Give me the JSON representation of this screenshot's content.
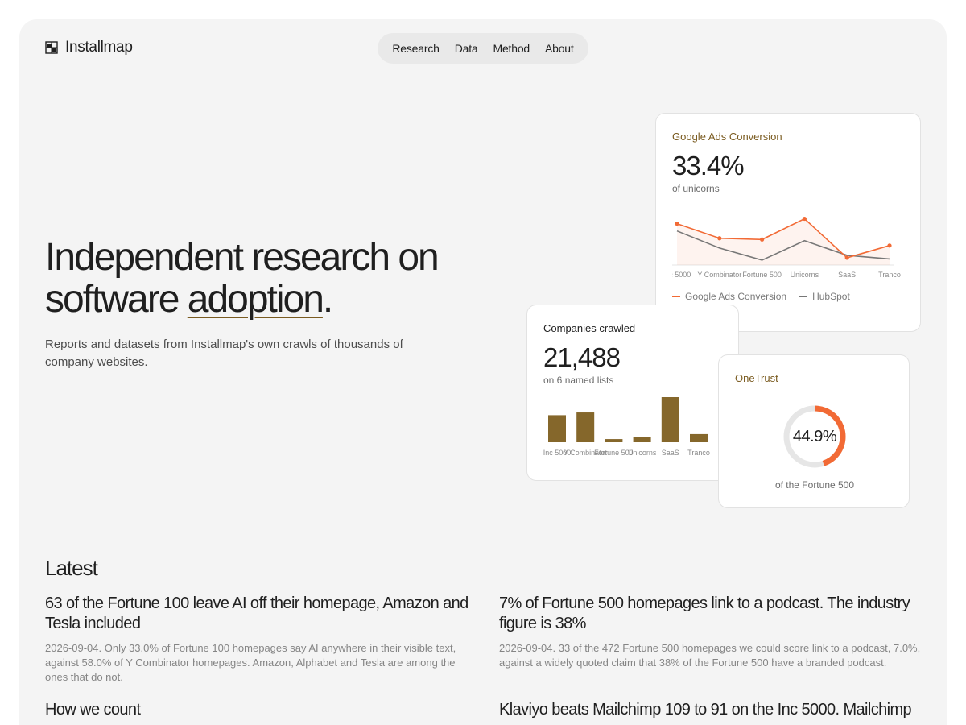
{
  "brand": {
    "name": "Installmap",
    "logo_icon": "grid-logo-icon"
  },
  "nav": {
    "items": [
      "Research",
      "Data",
      "Method",
      "About"
    ]
  },
  "hero": {
    "title_line1": "Independent research on",
    "title_line2_a": "software ",
    "title_line2_b": "adoption",
    "title_line2_c": ".",
    "subtitle": "Reports and datasets from Installmap's own crawls of thousands of company websites."
  },
  "cards": {
    "google_ads": {
      "label": "Google Ads Conversion",
      "value": "33.4%",
      "caption": "of unicorns"
    },
    "companies": {
      "label": "Companies crawled",
      "value": "21,488",
      "caption": "on 6 named lists"
    },
    "onetrust": {
      "label": "OneTrust",
      "value": "44.9%",
      "caption": "of the Fortune 500"
    }
  },
  "chart_data": [
    {
      "type": "line",
      "categories": [
        "Inc 5000",
        "Y Combinator",
        "Fortune 500",
        "Unicorns",
        "SaaS",
        "Tranco"
      ],
      "series": [
        {
          "name": "Google Ads Conversion",
          "values": [
            34,
            22,
            21,
            38,
            6,
            16
          ],
          "color": "#f26a35"
        },
        {
          "name": "HubSpot",
          "values": [
            28,
            14,
            4,
            20,
            8,
            5
          ],
          "color": "#777777"
        }
      ],
      "ylim": [
        0,
        45
      ],
      "legend": "bottom-left",
      "grid": false
    },
    {
      "type": "bar",
      "categories": [
        "Inc 5000",
        "Y Combinator",
        "Fortune 500",
        "Unicorns",
        "SaaS",
        "Tranco"
      ],
      "values": [
        3000,
        3300,
        350,
        600,
        5000,
        900
      ],
      "color": "#85672b"
    },
    {
      "type": "pie",
      "values": [
        44.9,
        55.1
      ],
      "colors": [
        "#f26a35",
        "#e6e6e6"
      ]
    }
  ],
  "latest": {
    "heading": "Latest",
    "articles": [
      {
        "title": "63 of the Fortune 100 leave AI off their homepage, Amazon and Tesla included",
        "desc": "2026-09-04. Only 33.0% of Fortune 100 homepages say AI anywhere in their visible text, against 58.0% of Y Combinator homepages. Amazon, Alphabet and Tesla are among the ones that do not."
      },
      {
        "title": "7% of Fortune 500 homepages link to a podcast. The industry figure is 38%",
        "desc": "2026-09-04. 33 of the 472 Fortune 500 homepages we could score link to a podcast, 7.0%, against a widely quoted claim that 38% of the Fortune 500 have a branded podcast."
      },
      {
        "title": "How we count",
        "desc": ""
      },
      {
        "title": "Klaviyo beats Mailchimp 109 to 91 on the Inc 5000. Mailchimp",
        "desc": ""
      }
    ]
  }
}
